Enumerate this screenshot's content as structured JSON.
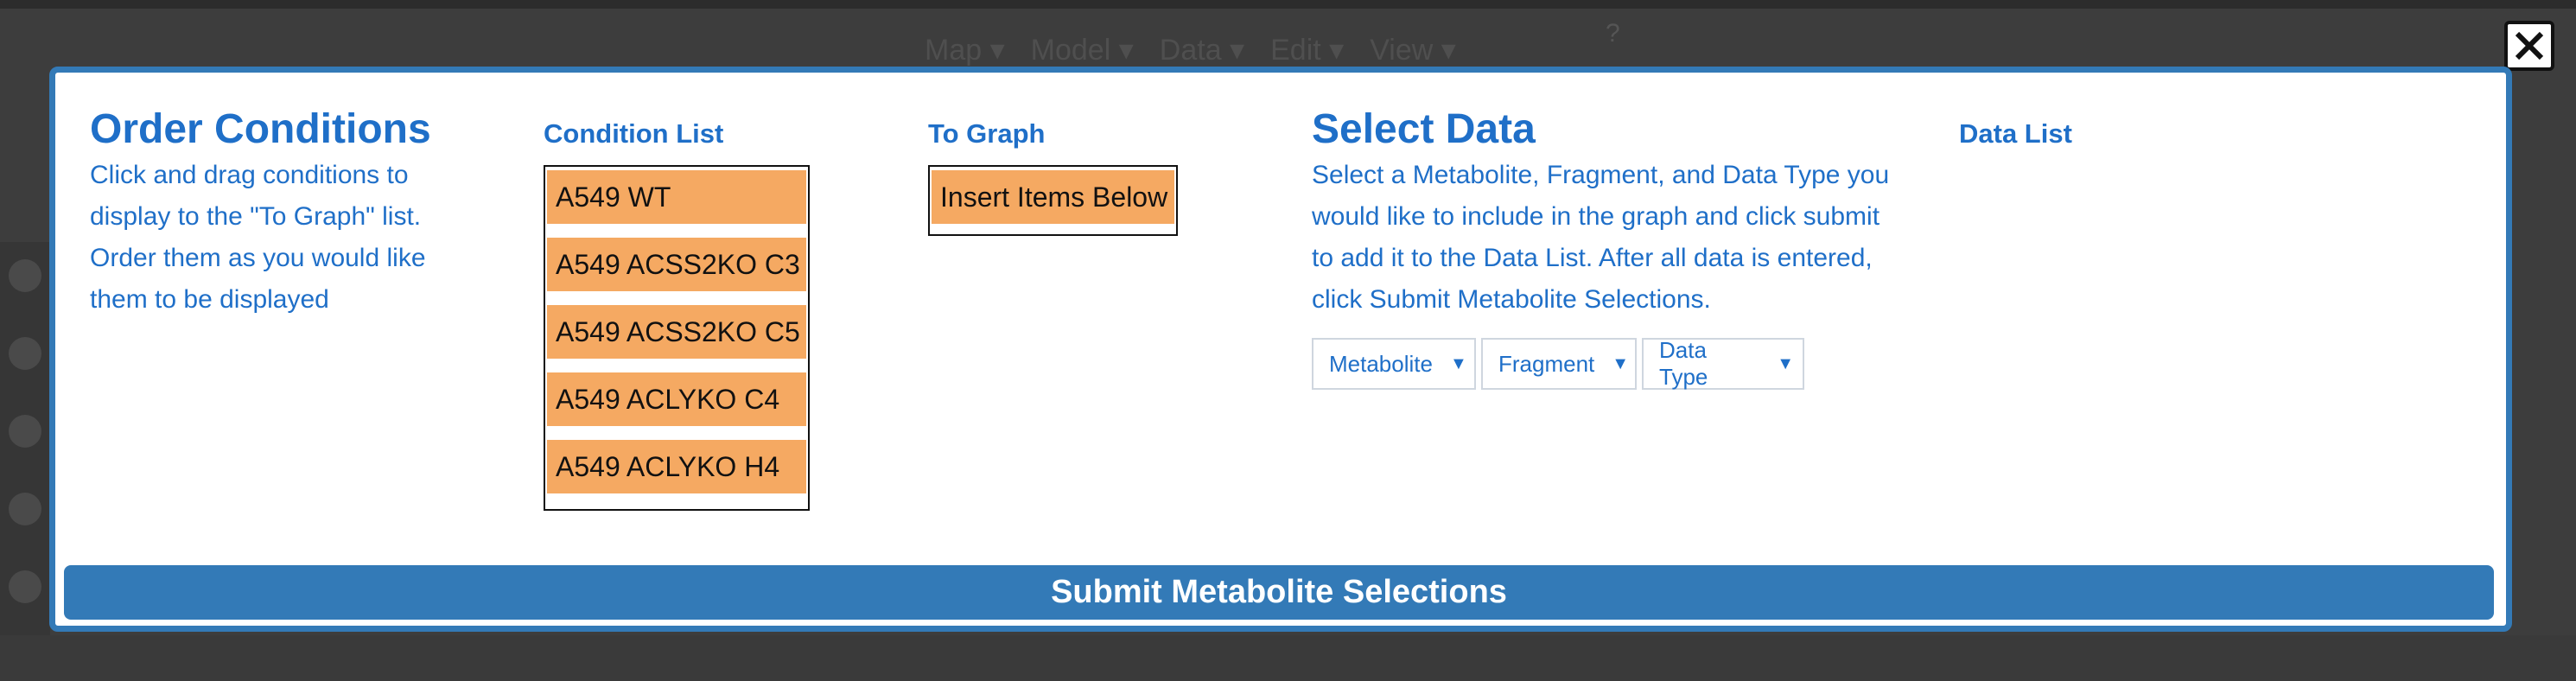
{
  "background": {
    "menu": [
      "Map",
      "Model",
      "Data",
      "Edit",
      "View"
    ],
    "help_label": "?"
  },
  "modal": {
    "order": {
      "title": "Order Conditions",
      "description": "Click and drag conditions to display to the \"To Graph\" list. Order them as you would like them to be displayed"
    },
    "condition_list": {
      "title": "Condition List",
      "items": [
        "A549 WT",
        "A549 ACSS2KO C3",
        "A549 ACSS2KO C5",
        "A549 ACLYKO C4",
        "A549 ACLYKO H4"
      ]
    },
    "to_graph": {
      "title": "To Graph",
      "placeholder_item": "Insert Items Below"
    },
    "select_data": {
      "title": "Select Data",
      "description": "Select a Metabolite, Fragment, and Data Type you would like to include in the graph and click submit to add it to the Data List. After all data is entered, click Submit Metabolite Selections.",
      "dropdowns": {
        "metabolite": "Metabolite",
        "fragment": "Fragment",
        "data_type": "Data Type"
      }
    },
    "data_list": {
      "title": "Data List"
    },
    "submit_label": "Submit Metabolite Selections"
  },
  "colors": {
    "accent": "#337ab7",
    "heading": "#1f6fc8",
    "condition_item": "#f5a962"
  },
  "icons": {
    "close": "close-icon",
    "dropdown": "chevron-down-icon"
  }
}
